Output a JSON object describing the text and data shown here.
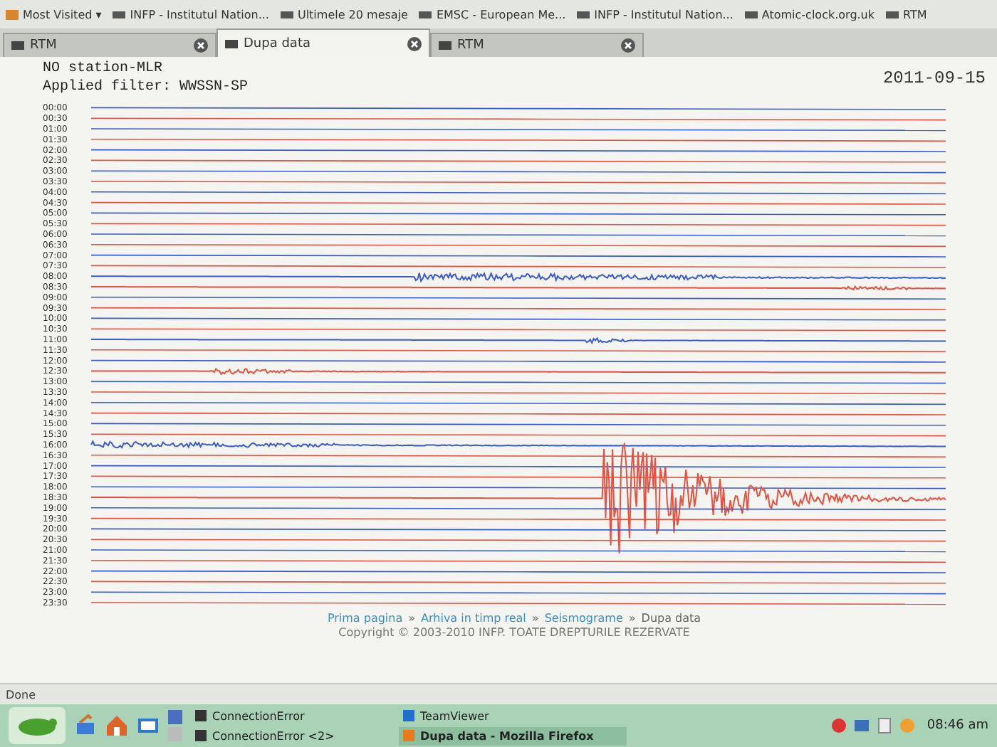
{
  "browser": {
    "bookmarks": [
      {
        "label": "Most Visited ▾"
      },
      {
        "label": "INFP - Institutul Nation..."
      },
      {
        "label": "Ultimele 20 mesaje"
      },
      {
        "label": "EMSC - European Me..."
      },
      {
        "label": "INFP - Institutul Nation..."
      },
      {
        "label": "Atomic-clock.org.uk"
      },
      {
        "label": "RTM"
      }
    ],
    "tabs": [
      {
        "label": "RTM",
        "selected": false
      },
      {
        "label": "Dupa data",
        "selected": true
      },
      {
        "label": "RTM",
        "selected": false
      }
    ]
  },
  "page": {
    "station": "NO station-MLR",
    "filter": "Applied filter: WWSSN-SP",
    "date": "2011-09-15",
    "seismogram": {
      "rows": [
        {
          "label": "00:00",
          "color": "#3a5bd0"
        },
        {
          "label": "00:30",
          "color": "#e8503f"
        },
        {
          "label": "01:00",
          "color": "#3a5bd0"
        },
        {
          "label": "01:30",
          "color": "#e8503f"
        },
        {
          "label": "02:00",
          "color": "#3a5bd0"
        },
        {
          "label": "02:30",
          "color": "#e8503f"
        },
        {
          "label": "03:00",
          "color": "#3a5bd0"
        },
        {
          "label": "03:30",
          "color": "#e8503f"
        },
        {
          "label": "04:00",
          "color": "#3a5bd0"
        },
        {
          "label": "04:30",
          "color": "#e8503f"
        },
        {
          "label": "05:00",
          "color": "#3a5bd0"
        },
        {
          "label": "05:30",
          "color": "#e8503f"
        },
        {
          "label": "06:00",
          "color": "#3a5bd0"
        },
        {
          "label": "06:30",
          "color": "#e8503f"
        },
        {
          "label": "07:00",
          "color": "#3a5bd0"
        },
        {
          "label": "07:30",
          "color": "#e8503f"
        },
        {
          "label": "08:00",
          "color": "#3a5bd0"
        },
        {
          "label": "08:30",
          "color": "#e8503f"
        },
        {
          "label": "09:00",
          "color": "#3a5bd0"
        },
        {
          "label": "09:30",
          "color": "#e8503f"
        },
        {
          "label": "10:00",
          "color": "#3a5bd0"
        },
        {
          "label": "10:30",
          "color": "#e8503f"
        },
        {
          "label": "11:00",
          "color": "#3a5bd0"
        },
        {
          "label": "11:30",
          "color": "#e8503f"
        },
        {
          "label": "12:00",
          "color": "#3a5bd0"
        },
        {
          "label": "12:30",
          "color": "#e8503f"
        },
        {
          "label": "13:00",
          "color": "#3a5bd0"
        },
        {
          "label": "13:30",
          "color": "#e8503f"
        },
        {
          "label": "14:00",
          "color": "#3a5bd0"
        },
        {
          "label": "14:30",
          "color": "#e8503f"
        },
        {
          "label": "15:00",
          "color": "#3a5bd0"
        },
        {
          "label": "15:30",
          "color": "#e8503f"
        },
        {
          "label": "16:00",
          "color": "#3a5bd0"
        },
        {
          "label": "16:30",
          "color": "#e8503f"
        },
        {
          "label": "17:00",
          "color": "#3a5bd0"
        },
        {
          "label": "17:30",
          "color": "#e8503f"
        },
        {
          "label": "18:00",
          "color": "#3a5bd0"
        },
        {
          "label": "18:30",
          "color": "#e8503f"
        },
        {
          "label": "19:00",
          "color": "#3a5bd0"
        },
        {
          "label": "19:30",
          "color": "#e8503f"
        },
        {
          "label": "20:00",
          "color": "#3a5bd0"
        },
        {
          "label": "20:30",
          "color": "#e8503f"
        },
        {
          "label": "21:00",
          "color": "#3a5bd0"
        },
        {
          "label": "21:30",
          "color": "#e8503f"
        },
        {
          "label": "22:00",
          "color": "#3a5bd0"
        },
        {
          "label": "22:30",
          "color": "#e8503f"
        },
        {
          "label": "23:00",
          "color": "#3a5bd0"
        },
        {
          "label": "23:30",
          "color": "#e8503f"
        }
      ]
    },
    "breadcrumb": [
      {
        "label": "Prima pagina",
        "link": true
      },
      {
        "label": "Arhiva in timp real",
        "link": true
      },
      {
        "label": "Seismograme",
        "link": true
      },
      {
        "label": "Dupa data",
        "link": false
      }
    ],
    "separator": "»",
    "copyright": "Copyright © 2003-2010 INFP. TOATE DREPTURILE REZERVATE"
  },
  "status_bar": {
    "text": "Done"
  },
  "taskbar": {
    "tasks": [
      {
        "label": "ConnectionError",
        "selected": false
      },
      {
        "label": "ConnectionError <2>",
        "selected": false
      },
      {
        "label": "TeamViewer",
        "selected": false
      },
      {
        "label": "Dupa data - Mozilla Firefox",
        "selected": true
      }
    ],
    "clock": "08:46 am"
  }
}
